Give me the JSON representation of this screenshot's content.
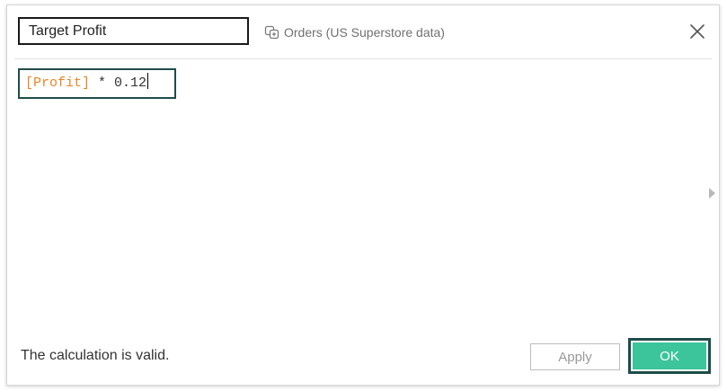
{
  "dialog": {
    "calculation_name": "Target Profit",
    "datasource_label": "Orders (US Superstore data)",
    "datasource_icon": "datasource-link-icon",
    "close_icon": "close-icon"
  },
  "formula": {
    "field": "[Profit]",
    "operator_value": " * 0.12"
  },
  "footer": {
    "status_text": "The calculation is valid.",
    "apply_label": "Apply",
    "ok_label": "OK"
  },
  "colors": {
    "field_token": "#e8862a",
    "ok_button": "#3cc49a",
    "focus_border": "#1e4d4a"
  }
}
